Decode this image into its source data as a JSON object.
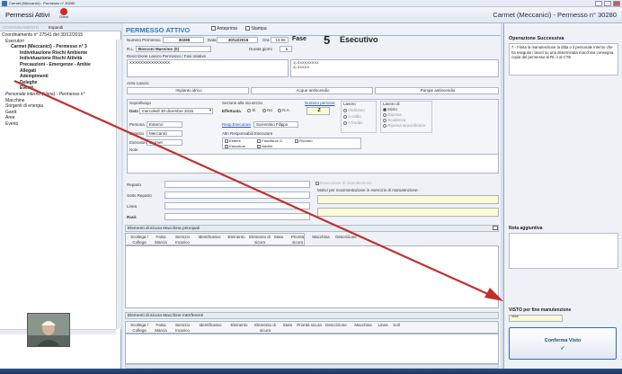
{
  "window": {
    "title": "Carmet (Meccanici) - Permesso n° 30280"
  },
  "header": {
    "title": "Permessi Attivi",
    "check_label": "Check",
    "right_title": "Carmet (Meccanici) - Permesso n° 30280"
  },
  "sidebar": {
    "tab_a": "COORDINAMENTO",
    "tab_b": "Espandi",
    "tree": [
      "Coordinamento n° 27541 del 30/12/2015",
      "Esecutori",
      "Carmet (Meccanici) - Permesso n° 3",
      "Individuazione Rischi Ambiente",
      "Individuazione Rischi Attività",
      "Precauzioni - Emergenze - Ambie",
      "Allegati",
      "Adempimenti",
      "Deleghe",
      "Eventi",
      "Personale interno (Varie) - Permesso n°",
      "Macchine",
      "Sorgenti di energia",
      "Gantt",
      "Aree",
      "Eventi"
    ]
  },
  "main": {
    "title": "PERMESSO ATTIVO",
    "btn_anteprima": "Anteprima",
    "btn_stampa": "Stampa",
    "numero_label": "Numero Permesso",
    "numero": "30280",
    "data_label": "Data",
    "data": "30/12/2015",
    "ora_label": "Ora",
    "ora": "13.55",
    "fase_label": "Fase",
    "fase_num": "5",
    "fase_text": "Esecutivo",
    "rl_label": "R.L.",
    "rl_value": "Bosconi Massimo (0)",
    "durata_label": "Durata giorni",
    "durata": "5",
    "descr_label": "Descrizione Lavoro Permesso / Fasi relative",
    "descr_value": "XXXXXXXXXXXXXXX",
    "note1": "1) XXXXXXXXX",
    "note2": "2) XXXXX",
    "area_label": "Area Lavoro",
    "area1": "Impianto idrico",
    "area2": "Acque antincendio",
    "area3": "Pompe antincendio",
    "sopralluogo_label": "Sopralluogo",
    "data_sop_label": "Data",
    "data_sop": "mercoledì 30 dicembre 2015",
    "sezione_label": "Sezione alla sicurezza",
    "effettuata_label": "Effettuata",
    "si": "Sì",
    "no": "No",
    "na": "N.A.",
    "num_persone_label": "Numero persone",
    "num_persone": "2",
    "lavoro_label": "Lavoro",
    "lavoro_opts": [
      "Ordinario",
      "A caldo",
      "A freddo"
    ],
    "lavoro_di_label": "Lavoro di",
    "lavoro_di_opts": [
      "Inizio",
      "Ripresa",
      "Scadenza",
      "Ripresa straordinaria"
    ],
    "pers_label": "Persona",
    "pers_value": "Esterno",
    "resp_label": "Resp.Esecutore",
    "resp_value": "Sorrentino Filippo",
    "servizio_label": "Servizio",
    "servizio_value": "Meccanici",
    "altri_label": "Altri Responsabili Esecutore",
    "altri_opts": [
      "Esterni",
      "Esecutore",
      "Fanciforce G.",
      "Navilin",
      "Ricciaro"
    ],
    "esecutore_label": "Esecutore",
    "esecutore_value": "Carmet",
    "note_label": "Note",
    "reparto_label": "Reparto",
    "sotto_label": "Sotto Reparto",
    "linea_label": "Linea",
    "rack_label": "Rack",
    "manut_chk": "Esecuzione di manutenzione",
    "motivi_label": "Motivi per movimentazione in esercizio di manutenzione:",
    "sect1": "Elementi di sicura Macchina principali",
    "sect2": "Elementi di sicura Macchine Interferenti",
    "cols1": [
      "Scollega / Collega",
      "Falsa Marcia",
      "Servizio Incarico",
      "Identificativo",
      "Elemento",
      "Elemento di sicura",
      "Stato",
      "Priorità sicura",
      "Macchina",
      "Descrizione"
    ],
    "cols2": [
      "Scollega / Collega",
      "Falsa Marcia",
      "Servizio Incarico",
      "Identificativo",
      "Elemento",
      "Elemento di sicura",
      "Stato",
      "Priorità sicura",
      "Descrizione",
      "Macchina",
      "Linea",
      "Soll"
    ]
  },
  "right": {
    "op_title": "Operazione Successiva",
    "op_text": "7 - Finita la manutenzione la ditta o il personale interno che ha eseguito i lavori su una determinata macchina consegna copia del permesso al RL o al CTE",
    "nota_title": "Nota aggiuntiva",
    "visto_title": "VISTO per fine manutenzione",
    "visto_value": "****",
    "conferma": "Conferma Visto"
  },
  "colors": {
    "accent": "#3478c8",
    "arrow": "#c0302a",
    "check": "#d7261e"
  }
}
